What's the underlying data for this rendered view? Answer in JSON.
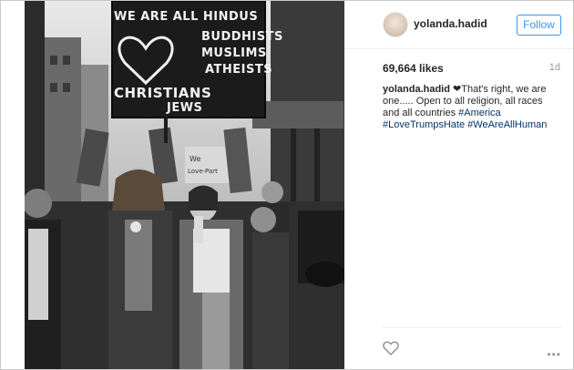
{
  "post": {
    "username": "yolanda.hadid",
    "follow_label": "Follow",
    "likes": "69,664 likes",
    "age": "1d",
    "caption": {
      "username": "yolanda.hadid",
      "heart_glyph": "❤",
      "text": "That's right, we are one..... Open to all religion, all races and all countries ",
      "tags": [
        "#America",
        "#LoveTrumpsHate",
        "#WeAreAllHuman"
      ]
    },
    "more_glyph": "•••"
  },
  "photo": {
    "sign_lines": [
      "We Are All Hindus",
      "Buddhists",
      "Muslims",
      "Atheists",
      "Christians",
      "Jews"
    ],
    "back_sign_lines": [
      "We",
      "Love-Part"
    ]
  },
  "colors": {
    "follow_blue": "#3897f0",
    "hashtag": "#003569",
    "meta_gray": "#999999"
  },
  "icons": [
    "heart-outline-icon",
    "more-options-icon"
  ]
}
